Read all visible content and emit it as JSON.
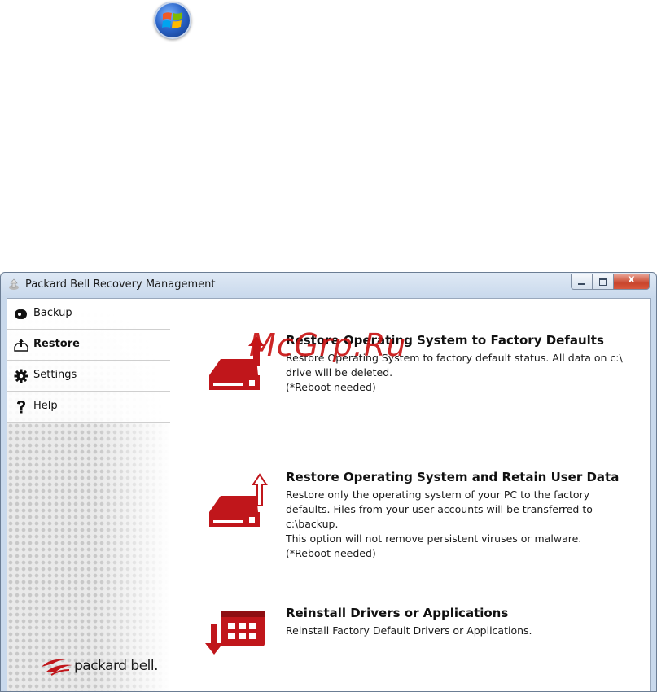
{
  "watermark": "McGrp.Ru",
  "window": {
    "title": "Packard Bell Recovery Management",
    "close_glyph": "x"
  },
  "sidebar": {
    "items": [
      {
        "label": "Backup",
        "icon": "disc-icon"
      },
      {
        "label": "Restore",
        "icon": "restore-upload-icon",
        "active": true
      },
      {
        "label": "Settings",
        "icon": "gear-icon"
      },
      {
        "label": "Help",
        "icon": "question-mark-icon"
      }
    ],
    "logo_text": "packard bell."
  },
  "options": [
    {
      "title": "Restore Operating System to Factory Defaults",
      "lines": [
        "Restore Operating System to factory default status. All data on c:\\",
        "drive will be deleted.",
        "(*Reboot needed)"
      ]
    },
    {
      "title": "Restore Operating System and Retain User Data",
      "lines": [
        "Restore only the operating system of your PC to the factory",
        "defaults. Files from your user accounts will be transferred to",
        "c:\\backup.",
        "This option will not remove persistent viruses or malware.",
        "(*Reboot needed)"
      ]
    },
    {
      "title": "Reinstall Drivers or Applications",
      "lines": [
        "Reinstall Factory Default Drivers or Applications."
      ]
    }
  ],
  "colors": {
    "accent": "#c0161b",
    "accent_dark": "#8e0e12"
  }
}
